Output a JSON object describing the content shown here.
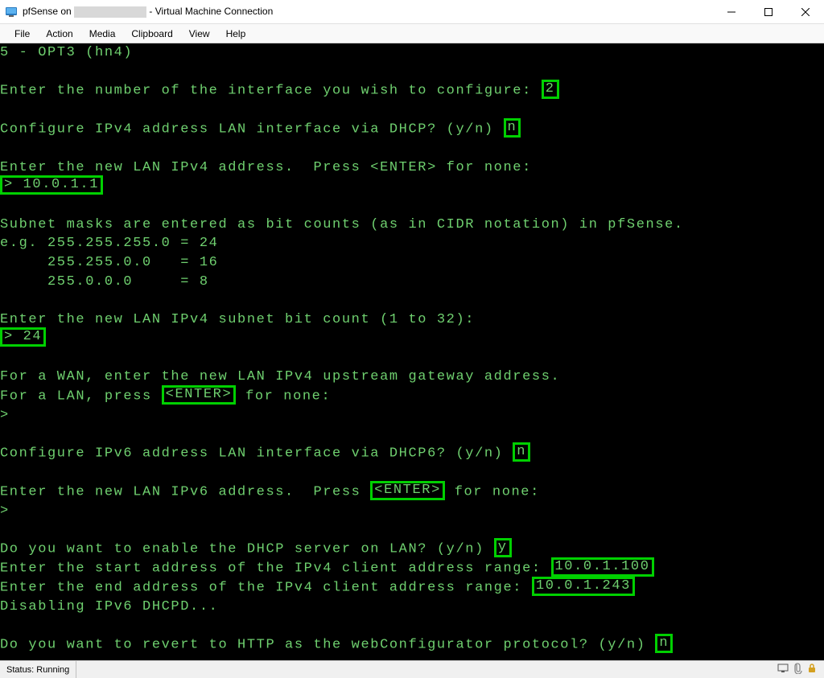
{
  "window": {
    "title_prefix": "pfSense on",
    "title_suffix": "- Virtual Machine Connection"
  },
  "menu": {
    "file": "File",
    "action": "Action",
    "media": "Media",
    "clipboard": "Clipboard",
    "view": "View",
    "help": "Help"
  },
  "term": {
    "l1a": "5 - OPT3 (hn4)",
    "l2a": "Enter the number of the interface you wish to configure: ",
    "l2b": "2",
    "l3a": "Configure IPv4 address LAN interface via DHCP? (y/n) ",
    "l3b": "n",
    "l4a": "Enter the new LAN IPv4 address.  Press <ENTER> for none:",
    "l5a": "> 10.0.1.1",
    "l6a": "Subnet masks are entered as bit counts (as in CIDR notation) in pfSense.",
    "l6b": "e.g. 255.255.255.0 = 24",
    "l6c": "     255.255.0.0   = 16",
    "l6d": "     255.0.0.0     = 8",
    "l7a": "Enter the new LAN IPv4 subnet bit count (1 to 32):",
    "l7b": "> 24",
    "l8a": "For a WAN, enter the new LAN IPv4 upstream gateway address.",
    "l8b": "For a LAN, press ",
    "l8c": "<ENTER>",
    "l8d": " for none:",
    "l8e": ">",
    "l9a": "Configure IPv6 address LAN interface via DHCP6? (y/n) ",
    "l9b": "n",
    "l10a": "Enter the new LAN IPv6 address.  Press ",
    "l10b": "<ENTER>",
    "l10c": " for none:",
    "l10d": ">",
    "l11a": "Do you want to enable the DHCP server on LAN? (y/n) ",
    "l11b": "y",
    "l12a": "Enter the start address of the IPv4 client address range: ",
    "l12b": "10.0.1.100",
    "l13a": "Enter the end address of the IPv4 client address range: ",
    "l13b": "10.0.1.243",
    "l14a": "Disabling IPv6 DHCPD...",
    "l15a": "Do you want to revert to HTTP as the webConfigurator protocol? (y/n) ",
    "l15b": "n"
  },
  "status": {
    "text": "Status: Running"
  }
}
